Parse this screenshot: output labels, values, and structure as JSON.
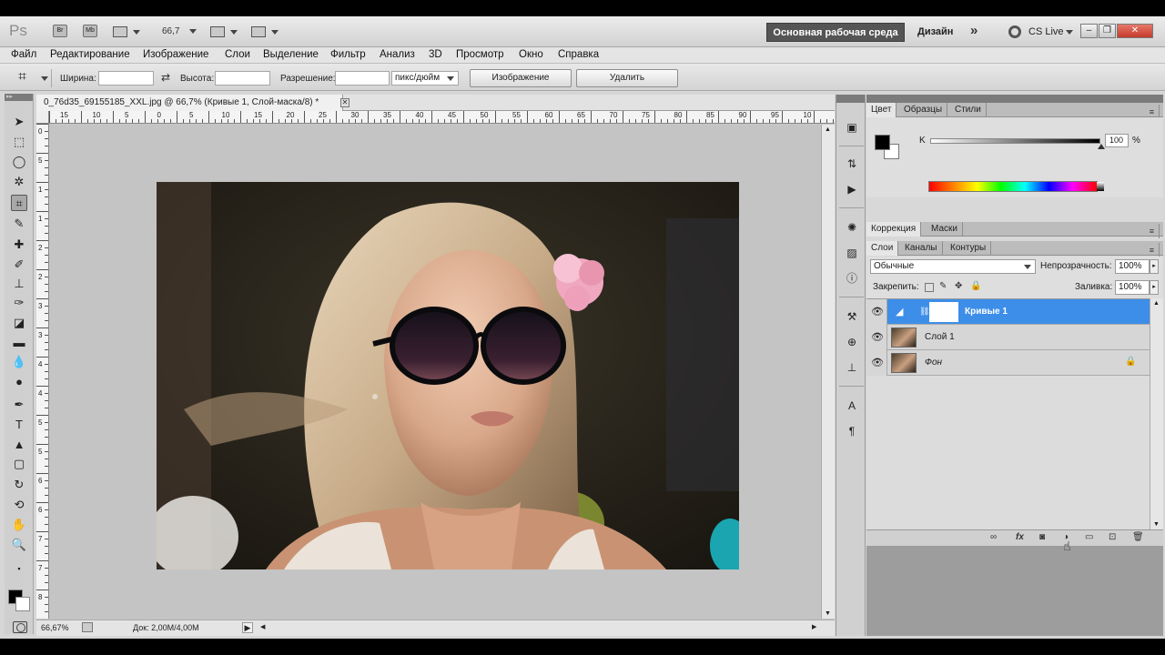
{
  "app": {
    "logo": "Ps",
    "bridge_label": "Br",
    "minibridge_label": "Mb",
    "zoom_value": "66,7",
    "workspace_active": "Основная рабочая среда",
    "workspace_design": "Дизайн",
    "cs_live": "CS Live"
  },
  "menu": {
    "items": [
      "Файл",
      "Редактирование",
      "Изображение",
      "Слои",
      "Выделение",
      "Фильтр",
      "Анализ",
      "3D",
      "Просмотр",
      "Окно",
      "Справка"
    ]
  },
  "options": {
    "width_label": "Ширина:",
    "height_label": "Высота:",
    "resolution_label": "Разрешение:",
    "units": "пикс/дюйм",
    "image_button": "Изображение",
    "delete_button": "Удалить"
  },
  "document": {
    "tab_title": "0_76d35_69155185_XXL.jpg @ 66,7% (Кривые 1, Слой-маска/8) *",
    "ruler_h": [
      "15",
      "10",
      "5",
      "0",
      "5",
      "10",
      "15",
      "20",
      "25",
      "30",
      "35",
      "40",
      "45",
      "50",
      "55",
      "60",
      "65",
      "70",
      "75",
      "80",
      "85",
      "90",
      "95",
      "10"
    ],
    "ruler_v": [
      "0",
      "5",
      "1",
      "1",
      "2",
      "2",
      "3",
      "3",
      "4",
      "4",
      "5",
      "5",
      "6",
      "6",
      "7",
      "7",
      "8"
    ],
    "status_zoom": "66,67%",
    "status_doc": "Док: 2,00M/4,00M"
  },
  "color_panel": {
    "tabs": [
      "Цвет",
      "Образцы",
      "Стили"
    ],
    "k_label": "K",
    "k_value": "100",
    "k_unit": "%",
    "k_level_percent": 100
  },
  "adjust_panel": {
    "tabs": [
      "Коррекция",
      "Маски"
    ]
  },
  "layers_panel": {
    "tabs": [
      "Слои",
      "Каналы",
      "Контуры"
    ],
    "blend_mode": "Обычные",
    "opacity_label": "Непрозрачность:",
    "opacity_value": "100%",
    "lock_label": "Закрепить:",
    "fill_label": "Заливка:",
    "fill_value": "100%",
    "layers": [
      {
        "name": "Кривые 1"
      },
      {
        "name": "Слой 1"
      },
      {
        "name": "Фон"
      }
    ]
  }
}
